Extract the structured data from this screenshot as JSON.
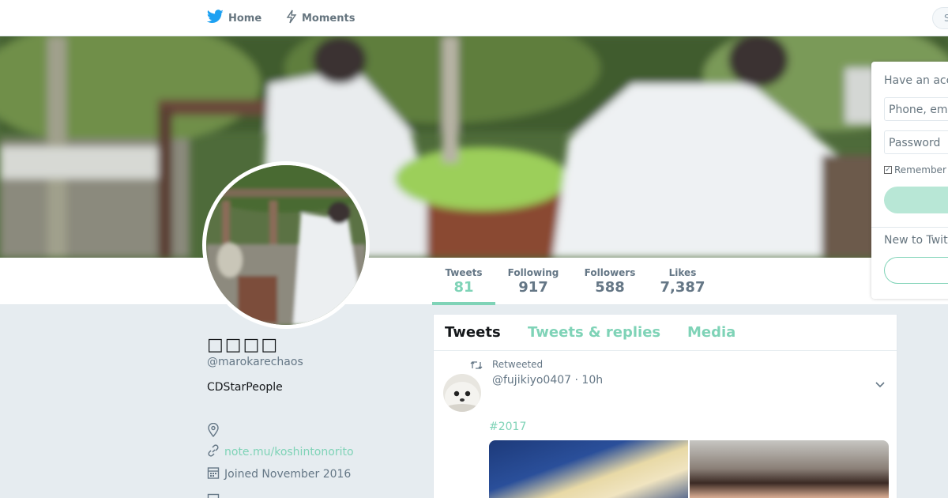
{
  "nav": {
    "home_label": "Home",
    "moments_label": "Moments",
    "search_placeholder": "S"
  },
  "stats": {
    "tweets": {
      "label": "Tweets",
      "value": "81"
    },
    "following": {
      "label": "Following",
      "value": "917"
    },
    "followers": {
      "label": "Followers",
      "value": "588"
    },
    "likes": {
      "label": "Likes",
      "value": "7,387"
    }
  },
  "profile": {
    "display_name": "□□□□",
    "handle": "@marokarechaos",
    "bio": "CDStarPeople",
    "url": "note.mu/koshintonorito",
    "joined": "Joined November 2016"
  },
  "timeline": {
    "tabs": [
      "Tweets",
      "Tweets & replies",
      "Media"
    ],
    "tweet": {
      "retweeted_label": "Retweeted",
      "author": "@fujikiyo0407",
      "time": "· 10h",
      "hashtag": "#2017"
    }
  },
  "login": {
    "title": "Have an account?",
    "username_placeholder": "Phone, email or username",
    "password_placeholder": "Password",
    "remember_label": "Remember me",
    "new_to_label": "New to Twitter?"
  },
  "colors": {
    "accent": "#7fd3b7",
    "twitter_blue": "#1da1f2",
    "muted": "#657786"
  }
}
